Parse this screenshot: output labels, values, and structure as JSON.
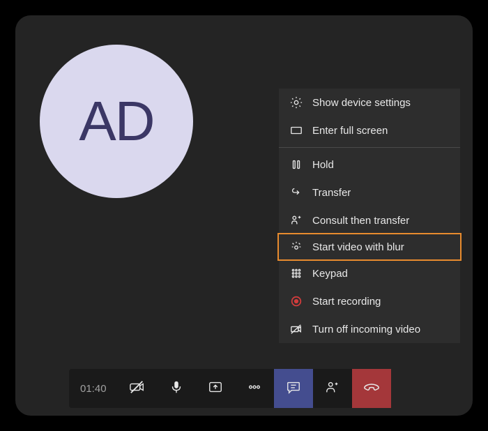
{
  "avatar": {
    "initials": "AD"
  },
  "menu": {
    "items": [
      {
        "icon": "gear-icon",
        "label": "Show device settings",
        "highlighted": false
      },
      {
        "icon": "fullscreen-icon",
        "label": "Enter full screen",
        "highlighted": false
      },
      {
        "divider": true
      },
      {
        "icon": "pause-icon",
        "label": "Hold",
        "highlighted": false
      },
      {
        "icon": "transfer-icon",
        "label": "Transfer",
        "highlighted": false
      },
      {
        "icon": "consult-icon",
        "label": "Consult then transfer",
        "highlighted": false
      },
      {
        "icon": "blur-icon",
        "label": "Start video with blur",
        "highlighted": true
      },
      {
        "icon": "keypad-icon",
        "label": "Keypad",
        "highlighted": false
      },
      {
        "icon": "record-icon",
        "label": "Start recording",
        "highlighted": false
      },
      {
        "icon": "video-off-icon",
        "label": "Turn off incoming video",
        "highlighted": false
      }
    ]
  },
  "toolbar": {
    "timer": "01:40"
  }
}
